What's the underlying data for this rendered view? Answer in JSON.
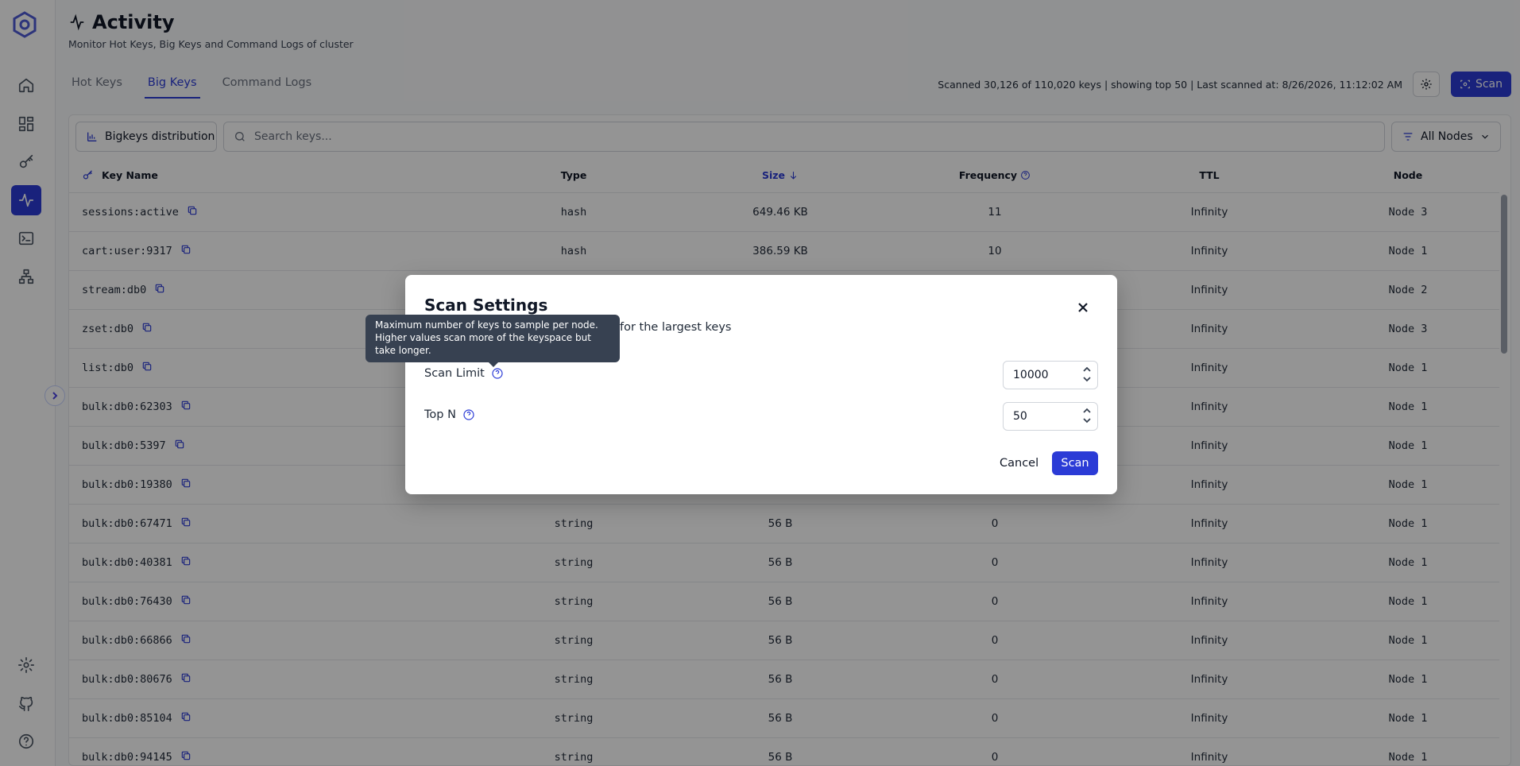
{
  "page": {
    "title": "Activity",
    "subtitle": "Monitor Hot Keys, Big Keys and Command Logs of cluster"
  },
  "tabs": [
    {
      "label": "Hot Keys",
      "active": false
    },
    {
      "label": "Big Keys",
      "active": true
    },
    {
      "label": "Command Logs",
      "active": false
    }
  ],
  "scan_status": "Scanned 30,126 of 110,020 keys | showing top 50 | Last scanned at: 8/26/2026, 11:12:02 AM",
  "top_actions": {
    "scan_label": "Scan"
  },
  "toolbar": {
    "distribution_label": "Bigkeys distribution",
    "search_placeholder": "Search keys...",
    "nodes_label": "All Nodes"
  },
  "table": {
    "columns": [
      "Key Name",
      "Type",
      "Size",
      "Frequency",
      "TTL",
      "Node"
    ],
    "rows": [
      {
        "key": "sessions:active",
        "type": "hash",
        "size": "649.46 KB",
        "frequency": "11",
        "ttl": "Infinity",
        "node": "Node 3"
      },
      {
        "key": "cart:user:9317",
        "type": "hash",
        "size": "386.59 KB",
        "frequency": "10",
        "ttl": "Infinity",
        "node": "Node 1"
      },
      {
        "key": "stream:db0",
        "type": "",
        "size": "",
        "frequency": "",
        "ttl": "Infinity",
        "node": "Node 2"
      },
      {
        "key": "zset:db0",
        "type": "",
        "size": "",
        "frequency": "",
        "ttl": "Infinity",
        "node": "Node 3"
      },
      {
        "key": "list:db0",
        "type": "",
        "size": "",
        "frequency": "",
        "ttl": "Infinity",
        "node": "Node 1"
      },
      {
        "key": "bulk:db0:62303",
        "type": "",
        "size": "",
        "frequency": "",
        "ttl": "Infinity",
        "node": "Node 1"
      },
      {
        "key": "bulk:db0:5397",
        "type": "",
        "size": "",
        "frequency": "",
        "ttl": "Infinity",
        "node": "Node 1"
      },
      {
        "key": "bulk:db0:19380",
        "type": "",
        "size": "",
        "frequency": "",
        "ttl": "Infinity",
        "node": "Node 1"
      },
      {
        "key": "bulk:db0:67471",
        "type": "string",
        "size": "56 B",
        "frequency": "0",
        "ttl": "Infinity",
        "node": "Node 1"
      },
      {
        "key": "bulk:db0:40381",
        "type": "string",
        "size": "56 B",
        "frequency": "0",
        "ttl": "Infinity",
        "node": "Node 1"
      },
      {
        "key": "bulk:db0:76430",
        "type": "string",
        "size": "56 B",
        "frequency": "0",
        "ttl": "Infinity",
        "node": "Node 1"
      },
      {
        "key": "bulk:db0:66866",
        "type": "string",
        "size": "56 B",
        "frequency": "0",
        "ttl": "Infinity",
        "node": "Node 1"
      },
      {
        "key": "bulk:db0:80676",
        "type": "string",
        "size": "56 B",
        "frequency": "0",
        "ttl": "Infinity",
        "node": "Node 1"
      },
      {
        "key": "bulk:db0:85104",
        "type": "string",
        "size": "56 B",
        "frequency": "0",
        "ttl": "Infinity",
        "node": "Node 1"
      },
      {
        "key": "bulk:db0:94145",
        "type": "string",
        "size": "56 B",
        "frequency": "0",
        "ttl": "Infinity",
        "node": "Node 1"
      }
    ]
  },
  "modal": {
    "title": "Scan Settings",
    "description_visible": "for the largest keys",
    "scan_limit_label": "Scan Limit",
    "scan_limit_value": "10000",
    "top_n_label": "Top N",
    "top_n_value": "50",
    "cancel_label": "Cancel",
    "scan_label": "Scan"
  },
  "tooltip": {
    "text": "Maximum number of keys to sample per node. Higher values scan more of the keyspace but take longer."
  },
  "colors": {
    "accent": "#2b3bd6",
    "overlay": "#000000"
  }
}
